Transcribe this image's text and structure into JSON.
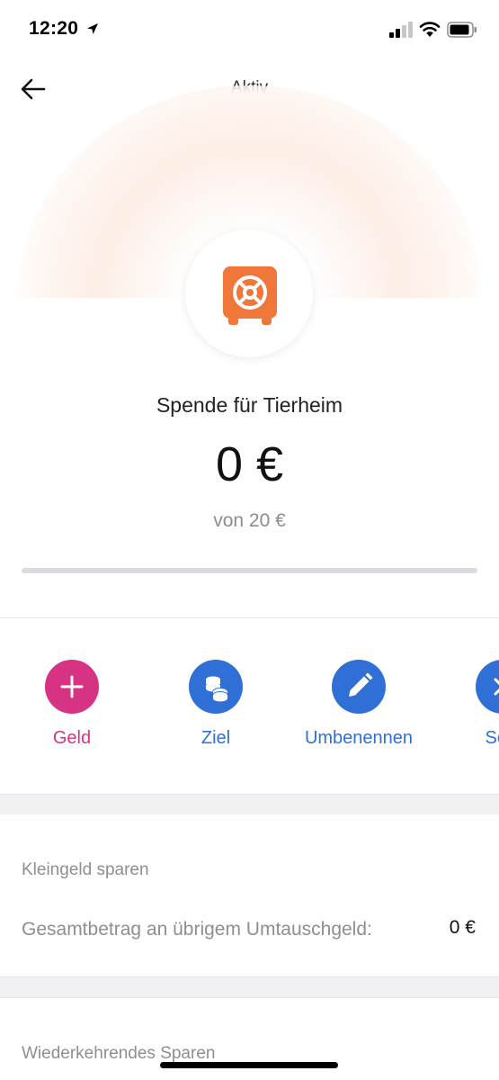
{
  "status_bar": {
    "time": "12:20"
  },
  "nav": {
    "title": "Aktiv"
  },
  "goal": {
    "icon": "safe-icon",
    "name": "Spende für Tierheim",
    "amount": "0 €",
    "target": "von 20 €",
    "progress_fraction": 0
  },
  "actions": [
    {
      "label": "Geld",
      "icon": "plus-icon",
      "color": "#d63384"
    },
    {
      "label": "Ziel",
      "icon": "coins-icon",
      "color": "#2f6fd6"
    },
    {
      "label": "Umbenennen",
      "icon": "pencil-icon",
      "color": "#2f6fd6"
    },
    {
      "label": "Schl",
      "icon": "close-icon",
      "color": "#2f6fd6"
    }
  ],
  "roundup": {
    "title": "Kleingeld sparen",
    "label": "Gesamtbetrag an übrigem Umtauschgeld:",
    "value": "0 €"
  },
  "recurring": {
    "title": "Wiederkehrendes Sparen"
  },
  "colors": {
    "accent_orange": "#f0773a",
    "pink": "#d63384",
    "blue": "#2f6fd6",
    "progress_track": "#d9dbe0"
  }
}
